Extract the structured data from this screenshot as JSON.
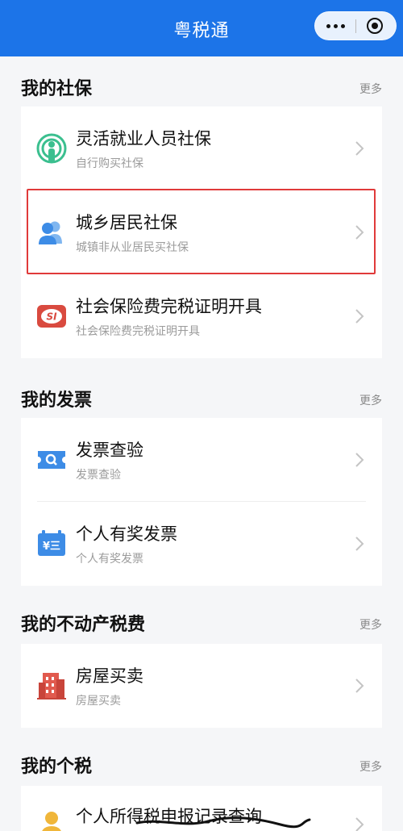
{
  "header": {
    "title": "粤税通"
  },
  "sections": [
    {
      "title": "我的社保",
      "more": "更多",
      "items": [
        {
          "title": "灵活就业人员社保",
          "subtitle": "自行购买社保"
        },
        {
          "title": "城乡居民社保",
          "subtitle": "城镇非从业居民买社保"
        },
        {
          "title": "社会保险费完税证明开具",
          "subtitle": "社会保险费完税证明开具"
        }
      ]
    },
    {
      "title": "我的发票",
      "more": "更多",
      "items": [
        {
          "title": "发票查验",
          "subtitle": "发票查验"
        },
        {
          "title": "个人有奖发票",
          "subtitle": "个人有奖发票"
        }
      ]
    },
    {
      "title": "我的不动产税费",
      "more": "更多",
      "items": [
        {
          "title": "房屋买卖",
          "subtitle": "房屋买卖"
        }
      ]
    },
    {
      "title": "我的个税",
      "more": "更多",
      "items": [
        {
          "title": "个人所得税申报记录查询",
          "subtitle": ""
        }
      ]
    }
  ],
  "icon_texts": {
    "si": "SI",
    "yuan": "¥三"
  },
  "colors": {
    "brand": "#1c74e8",
    "highlight_border": "#e03a3a",
    "icon_green": "#3bbf8f",
    "icon_blue": "#3d8ce6",
    "icon_red": "#d94a3f",
    "icon_yellow": "#f0b63a"
  }
}
